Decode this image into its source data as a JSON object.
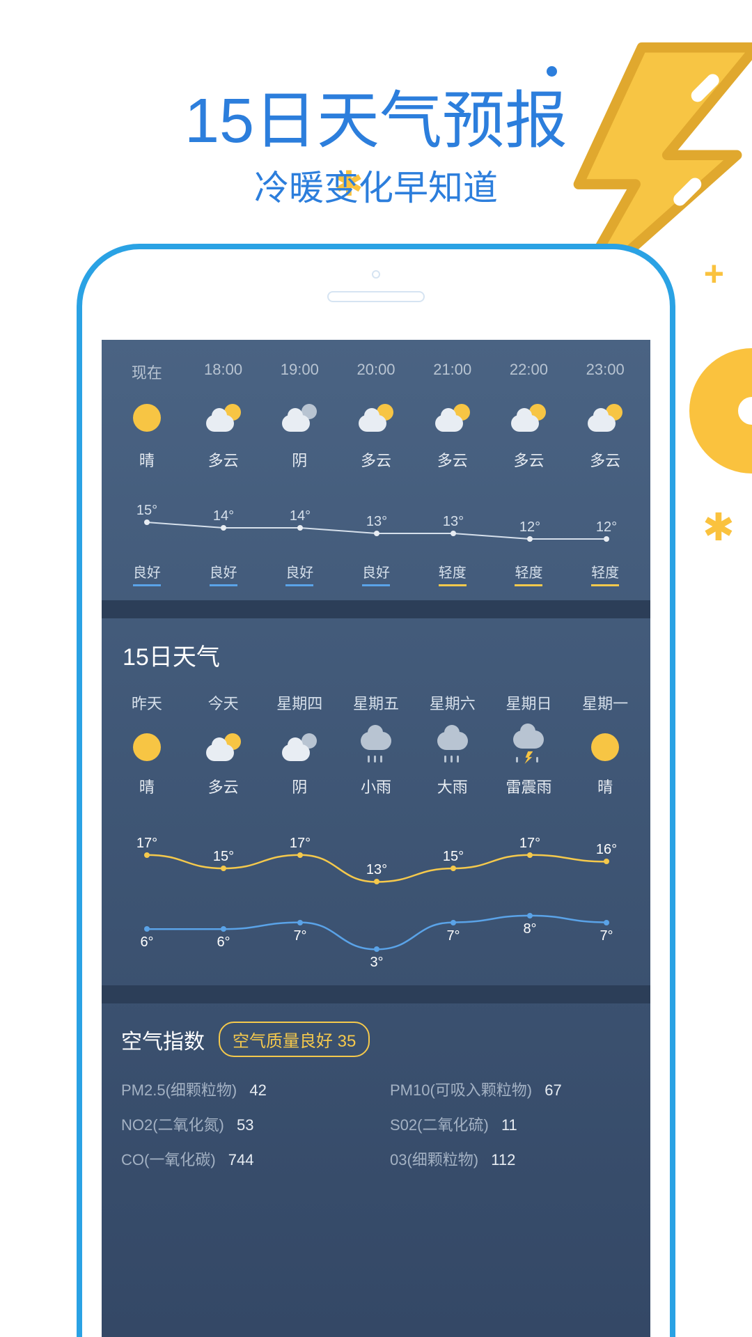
{
  "header": {
    "title": "15日天气预报",
    "subtitle": "冷暖变化早知道"
  },
  "hourly": {
    "cols": [
      {
        "time": "现在",
        "icon": "sun",
        "cond": "晴",
        "temp": "15°",
        "aqi": "良好",
        "aqiLevel": "good"
      },
      {
        "time": "18:00",
        "icon": "cloud-sun",
        "cond": "多云",
        "temp": "14°",
        "aqi": "良好",
        "aqiLevel": "good"
      },
      {
        "time": "19:00",
        "icon": "overcast",
        "cond": "阴",
        "temp": "14°",
        "aqi": "良好",
        "aqiLevel": "good"
      },
      {
        "time": "20:00",
        "icon": "cloud-sun",
        "cond": "多云",
        "temp": "13°",
        "aqi": "良好",
        "aqiLevel": "good"
      },
      {
        "time": "21:00",
        "icon": "cloud-sun",
        "cond": "多云",
        "temp": "13°",
        "aqi": "轻度",
        "aqiLevel": "light"
      },
      {
        "time": "22:00",
        "icon": "cloud-sun",
        "cond": "多云",
        "temp": "12°",
        "aqi": "轻度",
        "aqiLevel": "light"
      },
      {
        "time": "23:00",
        "icon": "cloud-sun",
        "cond": "多云",
        "temp": "12°",
        "aqi": "轻度",
        "aqiLevel": "light"
      }
    ]
  },
  "daily": {
    "title": "15日天气",
    "cols": [
      {
        "day": "昨天",
        "icon": "sun",
        "cond": "晴",
        "hi": "17°",
        "lo": "6°"
      },
      {
        "day": "今天",
        "icon": "cloud-sun",
        "cond": "多云",
        "hi": "15°",
        "lo": "6°"
      },
      {
        "day": "星期四",
        "icon": "overcast",
        "cond": "阴",
        "hi": "17°",
        "lo": "7°"
      },
      {
        "day": "星期五",
        "icon": "rain",
        "cond": "小雨",
        "hi": "13°",
        "lo": "3°"
      },
      {
        "day": "星期六",
        "icon": "rain",
        "cond": "大雨",
        "hi": "15°",
        "lo": "7°"
      },
      {
        "day": "星期日",
        "icon": "storm",
        "cond": "雷震雨",
        "hi": "17°",
        "lo": "8°"
      },
      {
        "day": "星期一",
        "icon": "sun",
        "cond": "晴",
        "hi": "16°",
        "lo": "7°"
      }
    ]
  },
  "air": {
    "title": "空气指数",
    "badge": "空气质量良好 35",
    "items": [
      {
        "label": "PM2.5(细颗粒物)",
        "val": "42"
      },
      {
        "label": "PM10(可吸入颗粒物)",
        "val": "67"
      },
      {
        "label": "NO2(二氧化氮)",
        "val": "53"
      },
      {
        "label": "S02(二氧化硫)",
        "val": "11"
      },
      {
        "label": "CO(一氧化碳)",
        "val": "744"
      },
      {
        "label": "03(细颗粒物)",
        "val": "112"
      }
    ]
  },
  "chart_data": {
    "hourly": {
      "type": "line",
      "categories": [
        "现在",
        "18:00",
        "19:00",
        "20:00",
        "21:00",
        "22:00",
        "23:00"
      ],
      "values": [
        15,
        14,
        14,
        13,
        13,
        12,
        12
      ],
      "ylim": [
        11,
        16
      ]
    },
    "daily": {
      "type": "line",
      "categories": [
        "昨天",
        "今天",
        "星期四",
        "星期五",
        "星期六",
        "星期日",
        "星期一"
      ],
      "series": [
        {
          "name": "high",
          "values": [
            17,
            15,
            17,
            13,
            15,
            17,
            16
          ]
        },
        {
          "name": "low",
          "values": [
            6,
            6,
            7,
            3,
            7,
            8,
            7
          ]
        }
      ],
      "ylim": [
        2,
        18
      ]
    }
  }
}
